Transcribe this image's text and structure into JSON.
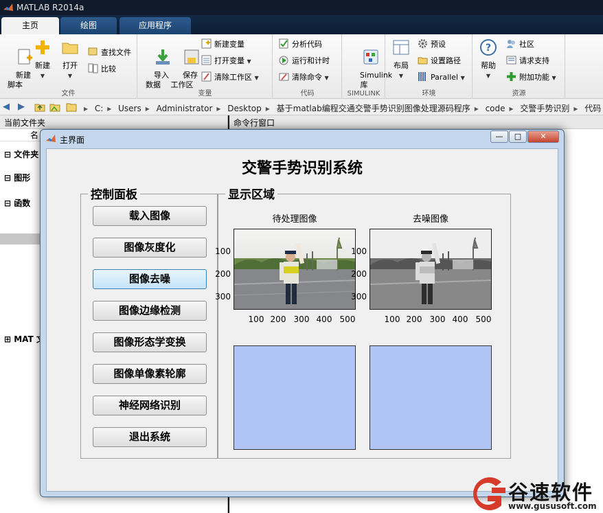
{
  "app": {
    "title": "MATLAB R2014a"
  },
  "tabs": [
    {
      "label": "主页"
    },
    {
      "label": "绘图"
    },
    {
      "label": "应用程序"
    }
  ],
  "ribbon": {
    "file": {
      "caption": "文件",
      "new_script": "新建\n脚本",
      "new": "新建",
      "open": "打开",
      "find_files": "查找文件",
      "compare": "比较"
    },
    "variable": {
      "caption": "变量",
      "import": "导入\n数据",
      "save_ws": "保存\n工作区",
      "new_var": "新建变量",
      "open_var": "打开变量",
      "clear_ws": "清除工作区"
    },
    "code": {
      "caption": "代码",
      "analyze": "分析代码",
      "run_time": "运行和计时",
      "clear_cmd": "清除命令"
    },
    "simulink": {
      "caption": "SIMULINK",
      "lib": "Simulink\n库"
    },
    "env": {
      "caption": "环境",
      "layout": "布局",
      "prefs": "预设",
      "set_path": "设置路径",
      "parallel": "Parallel"
    },
    "resources": {
      "caption": "资源",
      "help": "帮助",
      "community": "社区",
      "support": "请求支持",
      "addons": "附加功能"
    }
  },
  "address": {
    "segments": [
      "C:",
      "Users",
      "Administrator",
      "Desktop",
      "基于matlab编程交通交警手势识别图像处理源码程序",
      "code",
      "交警手势识别",
      "代码"
    ]
  },
  "left_panel": {
    "header": "当前文件夹",
    "col_name": "名",
    "groups": [
      "文件夹",
      "图形",
      "函数",
      "MAT 文"
    ]
  },
  "command_window": {
    "header": "命令行窗口"
  },
  "gui": {
    "window_title": "主界面",
    "title": "交警手势识别系统",
    "control_panel_title": "控制面板",
    "display_panel_title": "显示区域",
    "buttons": [
      "载入图像",
      "图像灰度化",
      "图像去噪",
      "图像边缘检测",
      "图像形态学变换",
      "图像单像素轮廓",
      "神经网络识别",
      "退出系统"
    ],
    "axes": [
      {
        "title": "待处理图像",
        "yticks": [
          "100",
          "200",
          "300"
        ],
        "xticks": [
          "100",
          "200",
          "300",
          "400",
          "500"
        ]
      },
      {
        "title": "去噪图像",
        "yticks": [
          "100",
          "200",
          "300"
        ],
        "xticks": [
          "100",
          "200",
          "300",
          "400",
          "500"
        ]
      }
    ]
  },
  "watermark": {
    "brand": "谷速软件",
    "url": "www.gususoft.com"
  },
  "colors": {
    "axes_blank": "#b0c4f6",
    "accent_red": "#d63a2a"
  }
}
